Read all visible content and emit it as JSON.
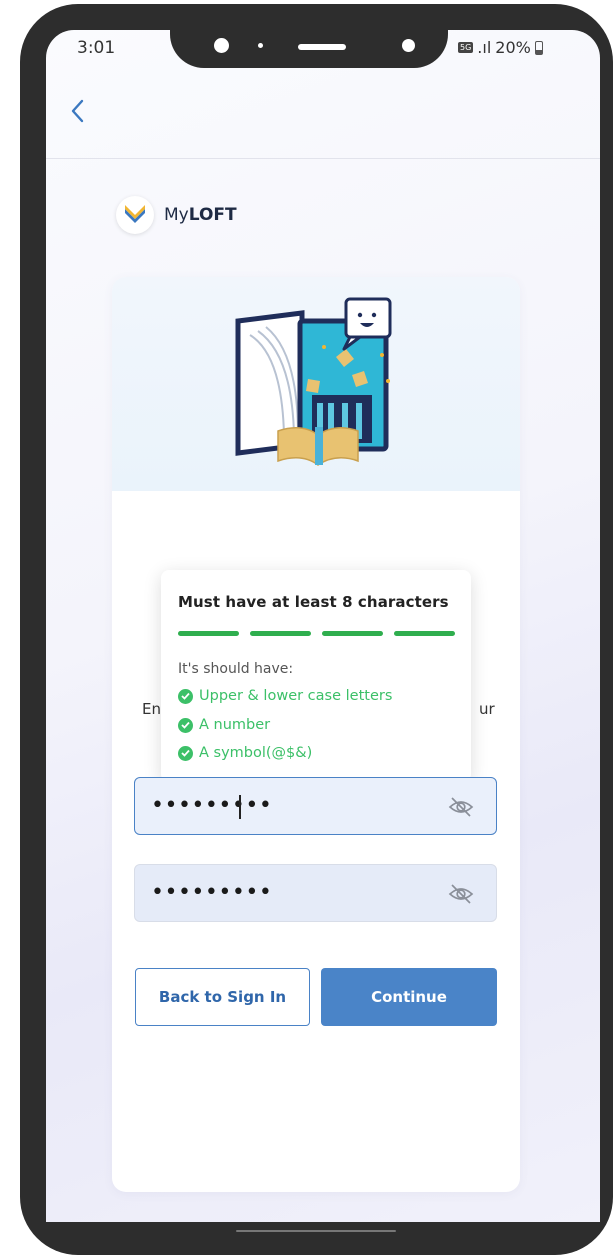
{
  "status_bar": {
    "time": "3:01",
    "network_badge": "5G",
    "signal": ".ıl",
    "battery": "20%"
  },
  "brand": {
    "prefix": "My",
    "suffix": "LOFT"
  },
  "password_tooltip": {
    "title": "Must have at least 8 characters",
    "strength_bars": 4,
    "subtitle": "It's should have:",
    "requirements": [
      "Upper & lower case letters",
      "A number",
      "A symbol(@$&)"
    ],
    "color": "#3cc068"
  },
  "partial_instruction": {
    "left": "En",
    "right": "ur"
  },
  "fields": {
    "password_value": "•••••••••",
    "confirm_value": "•••••••••"
  },
  "buttons": {
    "back": "Back to Sign In",
    "continue": "Continue"
  },
  "colors": {
    "primary": "#4a84c8",
    "success": "#2fae4e"
  }
}
